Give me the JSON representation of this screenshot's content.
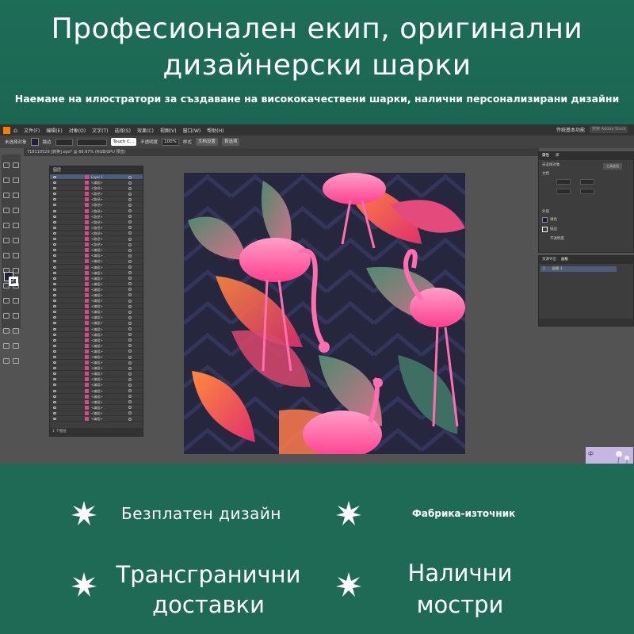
{
  "banner": {
    "headline_line1": "Професионален екип, оригинални",
    "headline_line2": "дизайнерски шарки",
    "subline": "Наемане на илюстратори за създаване на висококачествени шарки, налични персонализирани дизайни"
  },
  "app": {
    "menu_items": [
      "文件(F)",
      "编辑(E)",
      "对象(O)",
      "文字(T)",
      "选择(S)",
      "效果(C)",
      "视图(V)",
      "窗口(W)",
      "帮助(H)"
    ],
    "workspace_label": "传统基本功能",
    "search_placeholder": "搜索 Adobe Stock",
    "options": {
      "selection_label": "未选择对象",
      "stroke_label": "描边",
      "basic_label": "Touch C...",
      "opacity_label": "不透明度",
      "opacity_value": "100%",
      "style_label": "样式",
      "doc_setup": "文档设置",
      "prefs": "首选项"
    },
    "document_tab": "718110529 [转换].eps* @ 66.67% (RGB/GPU 预览)",
    "layers_panel": {
      "title": "图层",
      "layer_name": "Layer 1",
      "group_label": "<编组>",
      "path_label": "<路径>",
      "footer": "1 个图层"
    },
    "properties_panel": {
      "tabs": [
        "属性",
        "库"
      ],
      "no_selection": "未选择对象",
      "doc_button": "文档",
      "tool_button": "工具选项",
      "appearance": "外观",
      "fill": "填色",
      "stroke": "描边",
      "opacity": "不透明度"
    },
    "artboards_panel": {
      "tabs": [
        "资源导出",
        "画板"
      ],
      "item_index": "1",
      "item_name": "画板 1"
    },
    "preview_char": "中"
  },
  "features": {
    "f1": "Безплатен дизайн",
    "f2": "Фабрика-източник",
    "f3_line1": "Трансгранични",
    "f3_line2": "доставки",
    "f4_line1": "Налични",
    "f4_line2": "мостри"
  },
  "colors": {
    "band_green": "#1f6a55",
    "app_gray": "#535353",
    "artwork_bg": "#26273f",
    "flamingo_pink": "#ff5fa8"
  }
}
